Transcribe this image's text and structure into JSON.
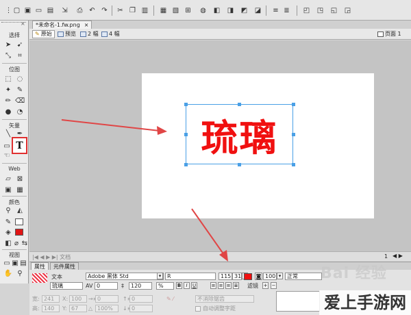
{
  "document": {
    "tab_title": "*未命名-1.fw.png",
    "tab_close": "×",
    "page_label": "页面 1"
  },
  "view_modes": [
    "原始",
    "预览",
    "2 幅",
    "4 幅"
  ],
  "tools_panel": {
    "sections": [
      "选择",
      "位图",
      "矢量",
      "Web",
      "颜色",
      "视图"
    ],
    "text_tool_glyph": "T",
    "close_glyph": "×"
  },
  "canvas": {
    "text": "琉璃",
    "text_color": "#f01010",
    "selection_color": "#4aa0e6",
    "background": "#ffffff"
  },
  "status": {
    "left": "|◀ ◀ ▶ ▶|  文档",
    "page_number": "1"
  },
  "properties": {
    "tabs": [
      "属性",
      "元件属性"
    ],
    "object_type": "文本",
    "object_name": "琉璃",
    "font_family": "Adobe 黑体 Std",
    "font_style": "R",
    "font_size": "115",
    "font_size_2": "31",
    "kerning": "0",
    "leading": "120",
    "leading_unit": "%",
    "opacity": "100",
    "blend_mode": "正常",
    "filters_label": "滤镜",
    "filters_add": "+",
    "bold": "B",
    "italic": "I",
    "underline": "U",
    "w_label": "宽:",
    "w_value": "241",
    "h_label": "高:",
    "h_value": "140",
    "x_label": "X:",
    "x_value": "100",
    "y_label": "Y:",
    "y_value": "67",
    "indent_value": "0",
    "space_before": "0",
    "space_after": "0",
    "scale_value": "100%",
    "antialias": "不消除锯齿",
    "auto_kern": "自动调整字距"
  },
  "watermark": {
    "baidu": "Bai 经验",
    "site": "爱上手游网"
  },
  "colors": {
    "accent_red": "#e03030",
    "arrow_red": "#e04646"
  }
}
